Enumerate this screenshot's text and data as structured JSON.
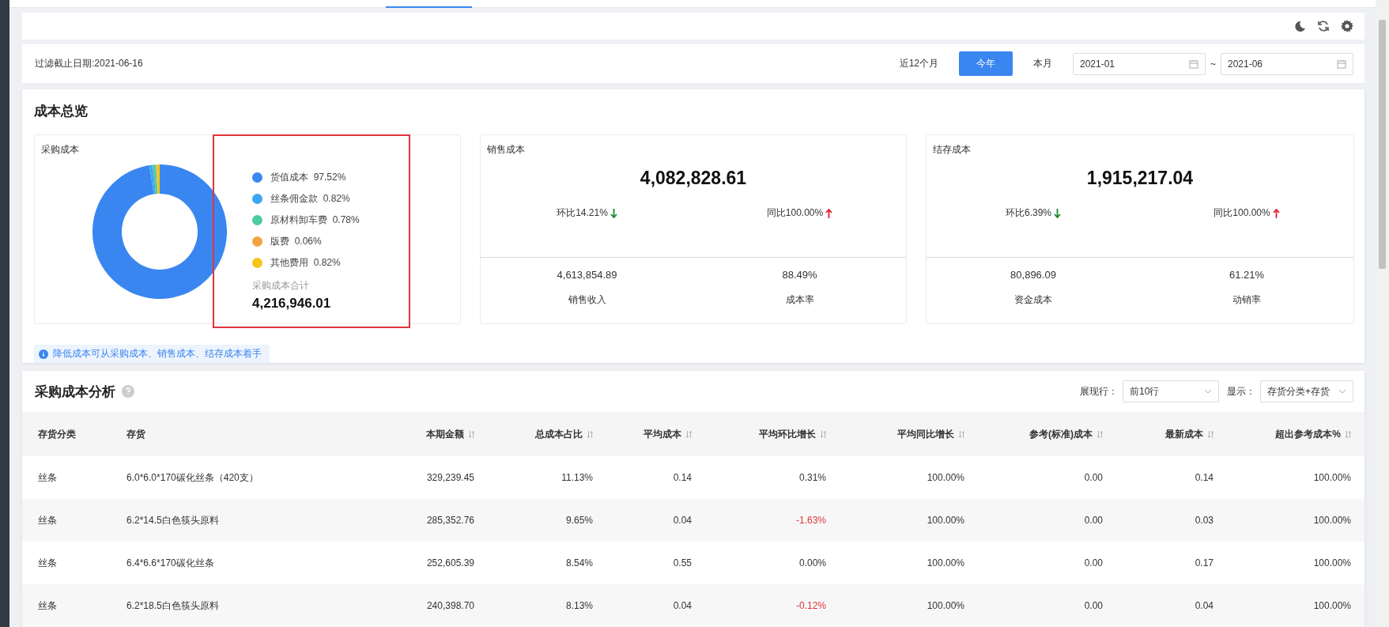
{
  "filter": {
    "cutoff": "过滤截止日期:2021-06-16",
    "ranges": [
      {
        "label": "近12个月",
        "selected": false
      },
      {
        "label": "今年",
        "selected": true
      },
      {
        "label": "本月",
        "selected": false
      }
    ],
    "date_from": "2021-01",
    "separator": "~",
    "date_to": "2021-06"
  },
  "overview": {
    "title": "成本总览",
    "purchase": {
      "title": "采购成本",
      "chart_data": {
        "type": "donut",
        "categories": [
          "货值成本",
          "丝条佣金款",
          "原材料卸车费",
          "版费",
          "其他费用"
        ],
        "values": [
          97.52,
          0.82,
          0.78,
          0.06,
          0.82
        ]
      },
      "legend": [
        {
          "percent": "97.52%",
          "color": "#3a86f0"
        },
        {
          "percent": "0.82%",
          "color": "#3ea6f2"
        },
        {
          "percent": "0.78%",
          "color": "#4ecba0"
        },
        {
          "percent": "0.06%",
          "color": "#f2a444"
        },
        {
          "percent": "0.82%",
          "color": "#f5c518"
        }
      ],
      "total_label": "采购成本合计",
      "total": "4,216,946.01"
    },
    "cards": [
      {
        "title": "销售成本",
        "amount": "4,082,828.61",
        "trends": [
          {
            "text": "环比14.21%",
            "kind": "down"
          },
          {
            "text": "同比100.00%",
            "kind": "up"
          }
        ],
        "metrics": [
          {
            "value": "4,613,854.89",
            "label": "销售收入"
          },
          {
            "value": "88.49%",
            "label": "成本率"
          }
        ]
      },
      {
        "title": "结存成本",
        "amount": "1,915,217.04",
        "trends": [
          {
            "text": "环比6.39%",
            "kind": "down"
          },
          {
            "text": "同比100.00%",
            "kind": "up"
          }
        ],
        "metrics": [
          {
            "value": "80,896.09",
            "label": "资金成本"
          },
          {
            "value": "61.21%",
            "label": "动销率"
          }
        ]
      }
    ],
    "note": "降低成本可从采购成本、销售成本、结存成本着手"
  },
  "analysis": {
    "title": "采购成本分析",
    "rows_label": "展现行：",
    "rows_value": "前10行",
    "show_label": "显示：",
    "show_value": "存货分类+存货",
    "columns": [
      {
        "label": "存货分类",
        "sortable": false
      },
      {
        "label": "存货",
        "sortable": false
      },
      {
        "label": "本期金额",
        "sortable": true
      },
      {
        "label": "总成本占比",
        "sortable": true
      },
      {
        "label": "平均成本",
        "sortable": true
      },
      {
        "label": "平均环比增长",
        "sortable": true
      },
      {
        "label": "平均同比增长",
        "sortable": true
      },
      {
        "label": "参考(标准)成本",
        "sortable": true
      },
      {
        "label": "最新成本",
        "sortable": true
      },
      {
        "label": "超出参考成本%",
        "sortable": true
      }
    ],
    "rows": [
      {
        "cells": [
          "丝条",
          "6.0*6.0*170碳化丝条（420支）",
          "329,239.45",
          "11.13%",
          "0.14",
          "0.31%",
          "100.00%",
          "0.00",
          "0.14",
          "100.00%"
        ],
        "mom_negative": false
      },
      {
        "cells": [
          "丝条",
          "6.2*14.5白色筷头原料",
          "285,352.76",
          "9.65%",
          "0.04",
          "-1.63%",
          "100.00%",
          "0.00",
          "0.03",
          "100.00%"
        ],
        "mom_negative": true
      },
      {
        "cells": [
          "丝条",
          "6.4*6.6*170碳化丝条",
          "252,605.39",
          "8.54%",
          "0.55",
          "0.00%",
          "100.00%",
          "0.00",
          "0.17",
          "100.00%"
        ],
        "mom_negative": false
      },
      {
        "cells": [
          "丝条",
          "6.2*18.5白色筷头原料",
          "240,398.70",
          "8.13%",
          "0.04",
          "-0.12%",
          "100.00%",
          "0.00",
          "0.04",
          "100.00%"
        ],
        "mom_negative": true
      }
    ]
  }
}
